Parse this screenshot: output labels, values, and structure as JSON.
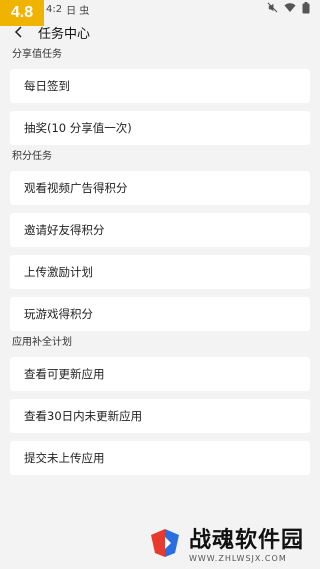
{
  "status_bar": {
    "badge": "4.8",
    "time": "4:2",
    "extra": "日 虫"
  },
  "header": {
    "title": "任务中心"
  },
  "sections": [
    {
      "label": "分享值任务",
      "items": [
        "每日签到",
        "抽奖(10 分享值一次)"
      ]
    },
    {
      "label": "积分任务",
      "items": [
        "观看视频广告得积分",
        "邀请好友得积分",
        "上传激励计划",
        "玩游戏得积分"
      ]
    },
    {
      "label": "应用补全计划",
      "items": [
        "查看可更新应用",
        "查看30日内未更新应用",
        "提交未上传应用"
      ]
    }
  ],
  "watermark": {
    "title": "战魂软件园",
    "url": "WWW.ZHLWSJX.COM"
  }
}
